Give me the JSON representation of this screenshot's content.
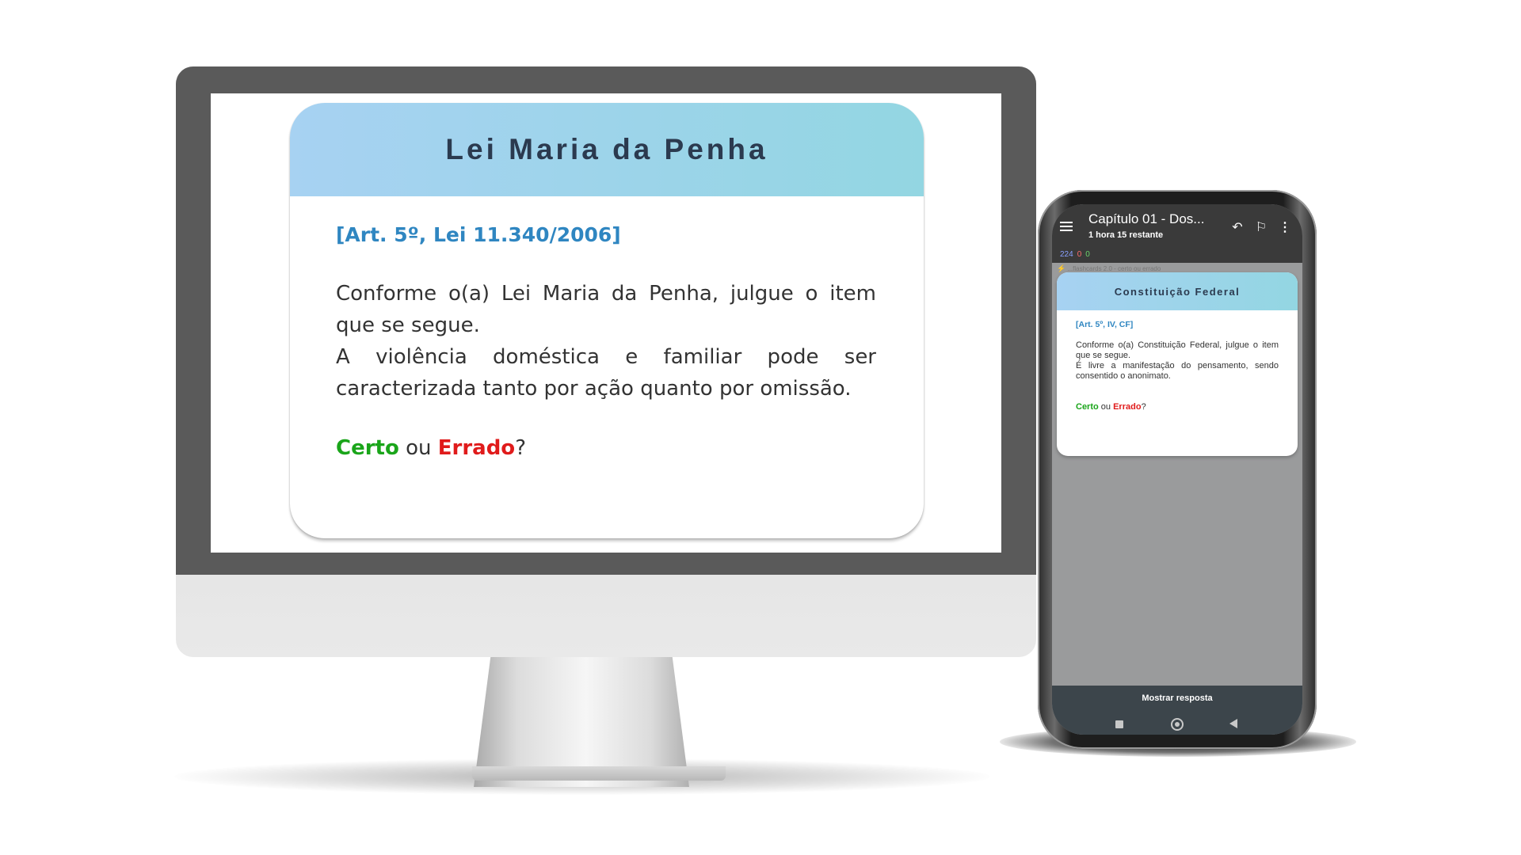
{
  "desktop": {
    "card": {
      "title": "Lei Maria da Penha",
      "reference": "[Art. 5º, Lei 11.340/2006]",
      "question_intro": "Conforme o(a) Lei Maria da Penha, julgue o item que se segue.",
      "question_statement": "A violência doméstica e familiar pode ser caracterizada tanto por ação quanto por omissão.",
      "answer_certo": "Certo",
      "answer_ou": " ou ",
      "answer_errado": "Errado",
      "answer_question_mark": "?"
    }
  },
  "phone": {
    "appbar": {
      "title": "Capítulo 01 - Dos...",
      "subtitle": "1 hora 15 restante",
      "undo_icon": "undo-icon",
      "flag_icon": "flag-icon",
      "more_icon": "more-vertical-icon",
      "menu_icon": "menu-icon"
    },
    "counts": {
      "new": "224",
      "learning": "0",
      "due": "0"
    },
    "deck_hint": "...flashcards 2.0 - certo ou errado",
    "card": {
      "title": "Constituição Federal",
      "reference": "[Art. 5º, IV, CF]",
      "question_intro": "Conforme o(a) Constituição Federal, julgue o item que se segue.",
      "question_statement": "É livre a manifestação do pensamento, sendo consentido o anonimato.",
      "answer_certo": "Certo",
      "answer_ou": " ou ",
      "answer_errado": "Errado",
      "answer_question_mark": "?"
    },
    "bottom_bar": {
      "show_answer_label": "Mostrar resposta"
    }
  },
  "colors": {
    "card_header_start": "#a7d2f2",
    "card_header_end": "#93d6e2",
    "reference_blue": "#2f86c1",
    "certo_green": "#1aa51a",
    "errado_red": "#e01b1b",
    "monitor_bezel": "#5a5a5a",
    "phone_appbar": "#3a3a3a",
    "phone_bottom_bar": "#3c454b"
  }
}
